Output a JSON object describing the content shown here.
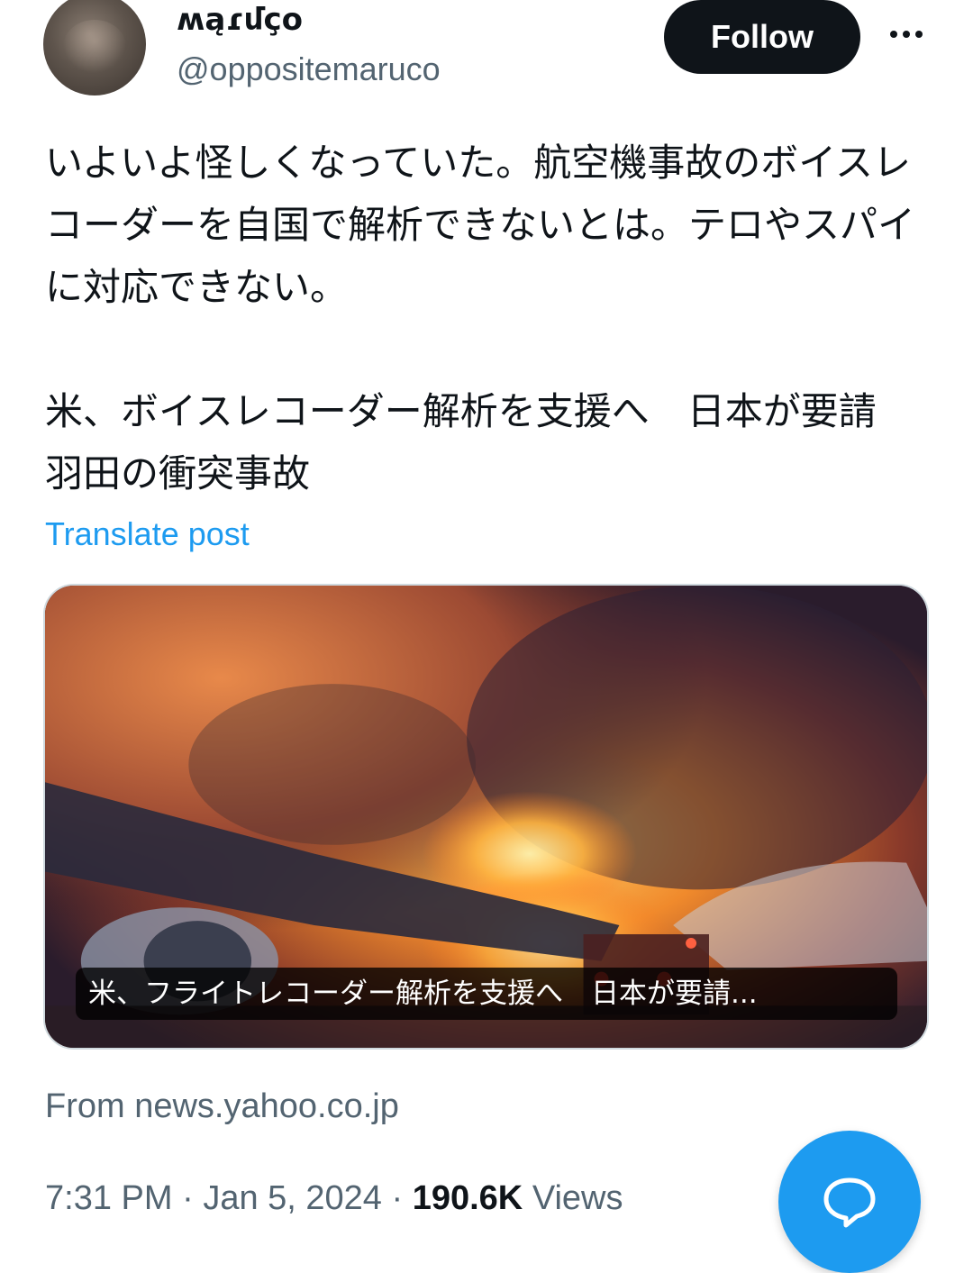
{
  "author": {
    "display_name": "ʍąɾմçօ",
    "handle": "@oppositemaruco"
  },
  "follow_label": "Follow",
  "tweet": {
    "text": "いよいよ怪しくなっていた。航空機事故のボイスレコーダーを自国で解析できないとは。テロやスパイに対応できない。\n\n米、ボイスレコーダー解析を支援へ　日本が要請　羽田の衝突事故",
    "translate_label": "Translate post"
  },
  "card": {
    "caption": "米、フライトレコーダー解析を支援へ　日本が要請...",
    "source": "From news.yahoo.co.jp"
  },
  "meta": {
    "time": "7:31 PM",
    "date": "Jan 5, 2024",
    "views_count": "190.6K",
    "views_label": "Views"
  },
  "icons": {
    "more": "more-horizontal-icon",
    "fab": "chat-bubble-icon"
  },
  "colors": {
    "accent": "#1d9bf0",
    "text_primary": "#0f1419",
    "text_secondary": "#536471",
    "follow_bg": "#0f1419"
  }
}
